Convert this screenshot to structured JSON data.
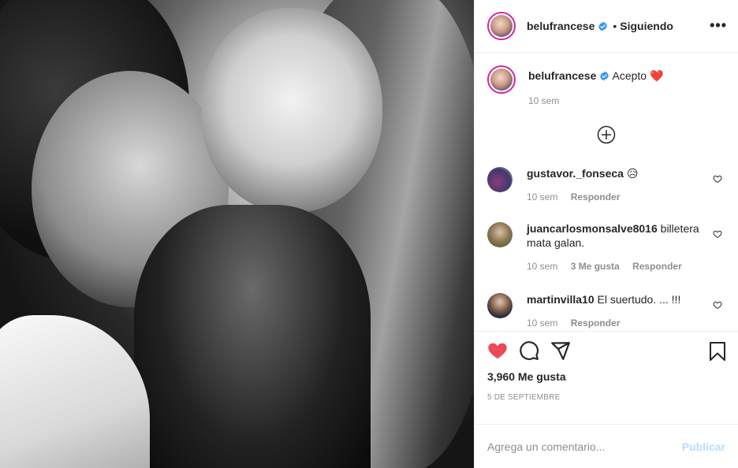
{
  "colors": {
    "verified": "#3897f0",
    "heart_red": "#ed4956",
    "muted": "#8e8e8e",
    "publish_disabled": "#b2dffc"
  },
  "header": {
    "username": "belufrancese",
    "separator": "•",
    "follow_status": "Siguiendo",
    "more_label": "•••"
  },
  "caption": {
    "username": "belufrancese",
    "text": "Acepto",
    "emoji": "❤️",
    "age": "10 sem"
  },
  "comments": [
    {
      "username": "gustavor._fonseca",
      "text": "😥",
      "age": "10 sem",
      "likes": "",
      "reply": "Responder"
    },
    {
      "username": "juancarlosmonsalve8016",
      "text": "billetera mata galan.",
      "age": "10 sem",
      "likes": "3 Me gusta",
      "reply": "Responder"
    },
    {
      "username": "martinvilla10",
      "text": "El suertudo. ... !!!",
      "age": "10 sem",
      "likes": "",
      "reply": "Responder"
    }
  ],
  "icons": {
    "like": "heart-filled-icon",
    "comment": "comment-bubble-icon",
    "share": "paper-plane-icon",
    "save": "bookmark-icon",
    "load_more": "plus-circle-icon",
    "comment_like": "heart-outline-icon"
  },
  "stats": {
    "likes": "3,960 Me gusta",
    "date": "5 de septiembre"
  },
  "add_comment": {
    "placeholder": "Agrega un comentario...",
    "publish": "Publicar"
  }
}
